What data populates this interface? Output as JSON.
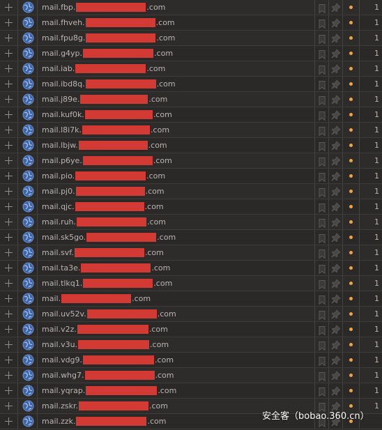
{
  "rows": [
    {
      "prefix": "mail.fbp.",
      "suffix": ".com",
      "count": "1"
    },
    {
      "prefix": "mail.fhveh.",
      "suffix": ".com",
      "count": "1"
    },
    {
      "prefix": "mail.fpu8g.",
      "suffix": ".com",
      "count": "1"
    },
    {
      "prefix": "mail.g4yp.",
      "suffix": ".com",
      "count": "1"
    },
    {
      "prefix": "mail.iab.",
      "suffix": ".com",
      "count": "1"
    },
    {
      "prefix": "mail.ibd8q.",
      "suffix": ".com",
      "count": "1"
    },
    {
      "prefix": "mail.j89e.",
      "suffix": ".com",
      "count": "1"
    },
    {
      "prefix": "mail.kuf0k.",
      "suffix": ".com",
      "count": "1"
    },
    {
      "prefix": "mail.l8i7k.",
      "suffix": ".com",
      "count": "1"
    },
    {
      "prefix": "mail.lbjw.",
      "suffix": ".com",
      "count": "1"
    },
    {
      "prefix": "mail.p6ye.",
      "suffix": ".com",
      "count": "1"
    },
    {
      "prefix": "mail.pio.",
      "suffix": ".com",
      "count": "1"
    },
    {
      "prefix": "mail.pj0.",
      "suffix": ".com",
      "count": "1"
    },
    {
      "prefix": "mail.qjc.",
      "suffix": ".com",
      "count": "1"
    },
    {
      "prefix": "mail.ruh.",
      "suffix": ".com",
      "count": "1"
    },
    {
      "prefix": "mail.sk5go.",
      "suffix": ".com",
      "count": "1"
    },
    {
      "prefix": "mail.svf.",
      "suffix": ".com",
      "count": "1"
    },
    {
      "prefix": "mail.ta3e.",
      "suffix": ".com",
      "count": "1"
    },
    {
      "prefix": "mail.tlkq1.",
      "suffix": ".com",
      "count": "1"
    },
    {
      "prefix": "mail.",
      "suffix": ".com",
      "count": "1"
    },
    {
      "prefix": "mail.uv52v.",
      "suffix": ".com",
      "count": "1"
    },
    {
      "prefix": "mail.v2z.",
      "suffix": ".com",
      "count": "1"
    },
    {
      "prefix": "mail.v3u.",
      "suffix": ".com",
      "count": "1"
    },
    {
      "prefix": "mail.vdg9.",
      "suffix": ".com",
      "count": "1"
    },
    {
      "prefix": "mail.whg7.",
      "suffix": ".com",
      "count": "1"
    },
    {
      "prefix": "mail.yqrap.",
      "suffix": ".com",
      "count": "1"
    },
    {
      "prefix": "mail.zskr.",
      "suffix": ".com",
      "count": "1"
    },
    {
      "prefix": "mail.zzk.",
      "suffix": ".com",
      "count": ""
    }
  ],
  "icons": {
    "expand": "plus-icon",
    "site": "globe-icon",
    "bookmark": "bookmark-icon",
    "pin": "pin-icon",
    "status": "status-dot-icon"
  },
  "colors": {
    "background": "#2c2a28",
    "text": "#b9b6b1",
    "redaction": "#d23a33",
    "status_dot": "#f2a43a",
    "globe": "#4a78c4"
  },
  "watermark": "安全客（bobao.360.cn）"
}
